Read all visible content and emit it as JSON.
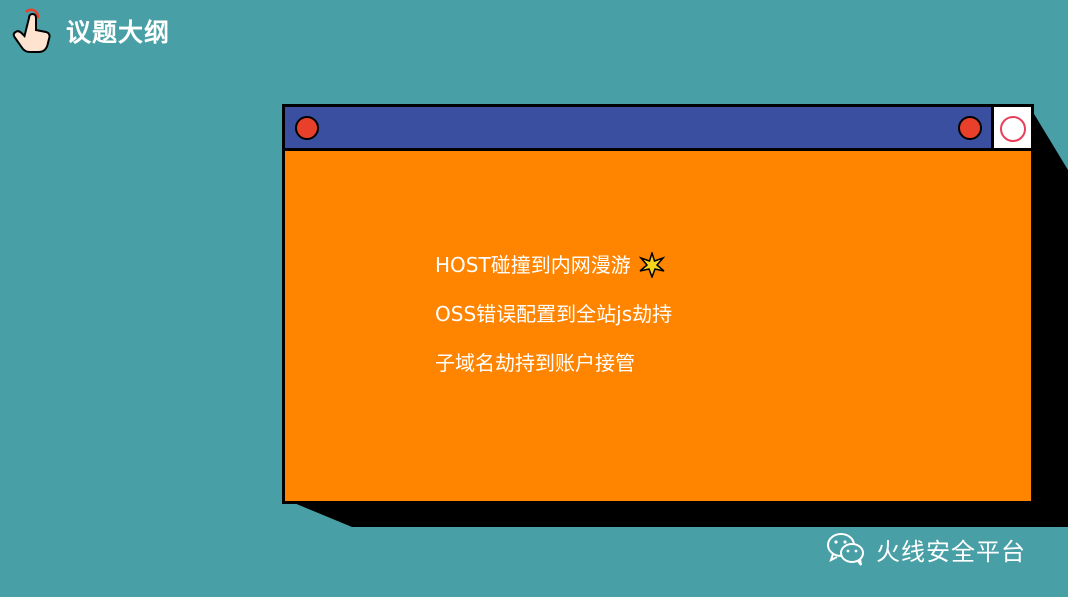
{
  "header": {
    "title": "议题大纲",
    "icon": "pointing-hand-icon"
  },
  "window": {
    "controls": [
      "red-dot-icon",
      "red-dot-icon",
      "close-ring-icon"
    ],
    "agenda": [
      {
        "text": "HOST碰撞到内网漫游",
        "icon": "spark-star-icon"
      },
      {
        "text": "OSS错误配置到全站js劫持"
      },
      {
        "text": "子域名劫持到账户接管"
      }
    ]
  },
  "footer": {
    "brand": "火线安全平台",
    "icon": "wechat-icon"
  },
  "colors": {
    "background": "#48a0a6",
    "window_body": "#ff8400",
    "window_header": "#3b4fa0",
    "dot": "#e8402b",
    "shadow": "#000000"
  }
}
